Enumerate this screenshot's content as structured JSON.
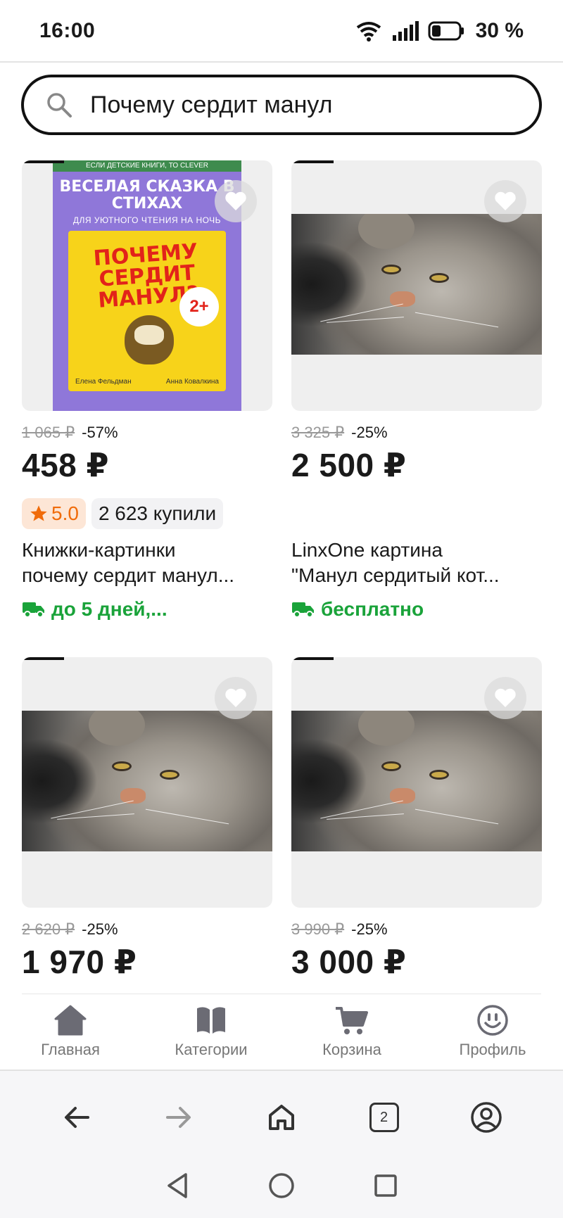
{
  "status_bar": {
    "time": "16:00",
    "battery": "30 %"
  },
  "search": {
    "query": "Почему сердит манул"
  },
  "products": [
    {
      "old_price": "1 065 ₽",
      "discount": "-57%",
      "price": "458 ₽",
      "rating": "5.0",
      "bought": "2 623 купили",
      "title_line1": "Книжки-картинки",
      "title_line2": "почему сердит манул...",
      "delivery": "до 5 дней,...",
      "image": "book-cover",
      "book": {
        "top": "ЕСЛИ ДЕТСКИЕ КНИГИ, ТО CLEVER",
        "title": "ВЕСЕЛАЯ СКАЗКА В СТИХАХ",
        "subtitle": "ДЛЯ УЮТНОГО ЧТЕНИЯ НА НОЧЬ",
        "cover_title": "ПОЧЕМУ СЕРДИТ МАНУЛ?",
        "age": "2+",
        "author1": "Елена Фельдман",
        "author2": "Анна Ковалкина"
      }
    },
    {
      "old_price": "3 325 ₽",
      "discount": "-25%",
      "price": "2 500 ₽",
      "title_line1": "LinxOne картина",
      "title_line2": "\"Манул сердитый кот...",
      "delivery": "бесплатно",
      "image": "manul-photo"
    },
    {
      "old_price": "2 620 ₽",
      "discount": "-25%",
      "price": "1 970 ₽",
      "image": "manul-photo"
    },
    {
      "old_price": "3 990 ₽",
      "discount": "-25%",
      "price": "3 000 ₽",
      "image": "manul-photo"
    }
  ],
  "app_nav": [
    {
      "label": "Главная",
      "icon": "home-icon"
    },
    {
      "label": "Категории",
      "icon": "book-icon"
    },
    {
      "label": "Корзина",
      "icon": "cart-icon"
    },
    {
      "label": "Профиль",
      "icon": "smiley-icon"
    }
  ],
  "browser": {
    "tab_count": "2"
  },
  "colors": {
    "accent_green": "#1aa33a",
    "rating_orange": "#f06b0a",
    "rating_bg": "#fde6d6"
  }
}
